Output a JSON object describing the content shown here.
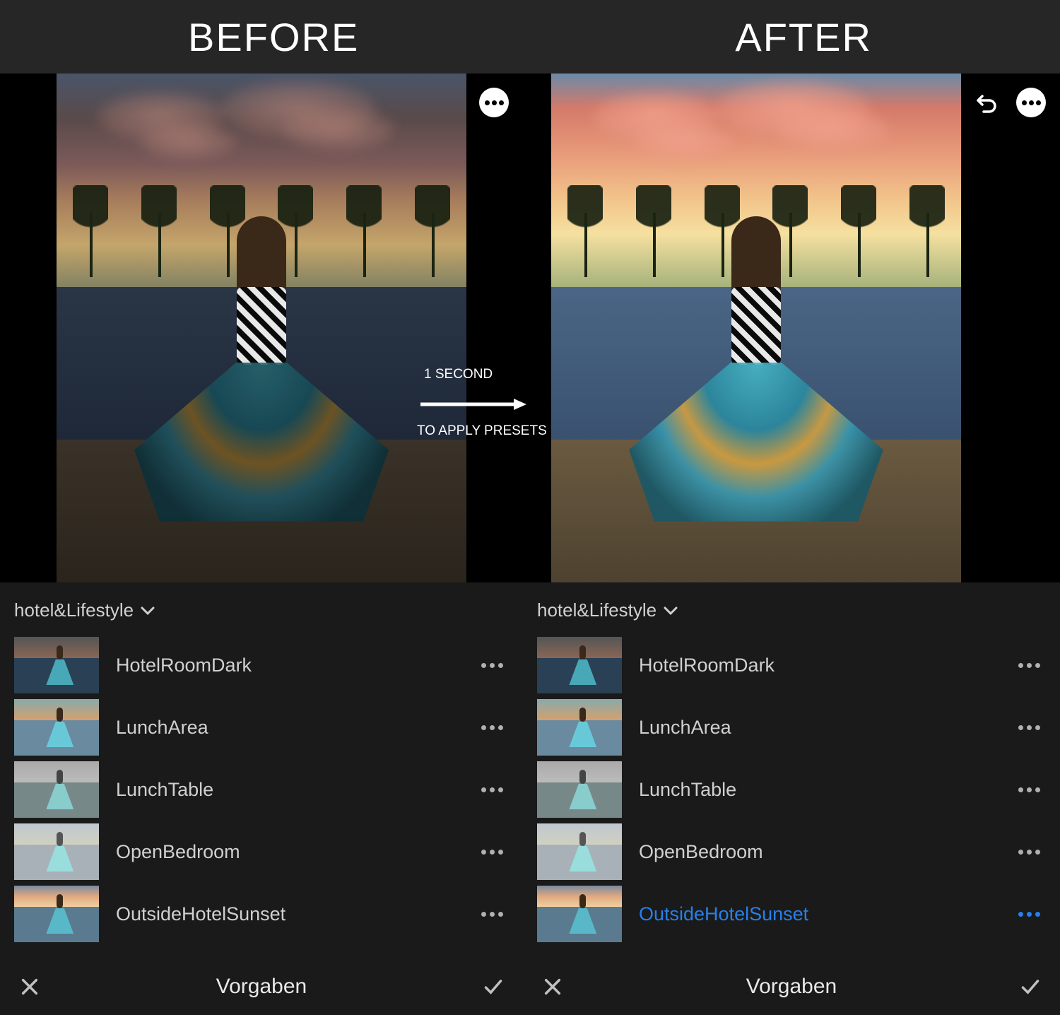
{
  "header": {
    "before_label": "BEFORE",
    "after_label": "AFTER"
  },
  "center_overlay": {
    "line1": "1 SECOND",
    "line2": "TO APPLY PRESETS"
  },
  "left_panel": {
    "category": "hotel&Lifestyle",
    "presets": [
      {
        "name": "HotelRoomDark",
        "selected": false
      },
      {
        "name": "LunchArea",
        "selected": false
      },
      {
        "name": "LunchTable",
        "selected": false
      },
      {
        "name": "OpenBedroom",
        "selected": false
      },
      {
        "name": "OutsideHotelSunset",
        "selected": false
      }
    ],
    "bottom_bar_title": "Vorgaben"
  },
  "right_panel": {
    "category": "hotel&Lifestyle",
    "presets": [
      {
        "name": "HotelRoomDark",
        "selected": false
      },
      {
        "name": "LunchArea",
        "selected": false
      },
      {
        "name": "LunchTable",
        "selected": false
      },
      {
        "name": "OpenBedroom",
        "selected": false
      },
      {
        "name": "OutsideHotelSunset",
        "selected": true
      }
    ],
    "bottom_bar_title": "Vorgaben"
  }
}
